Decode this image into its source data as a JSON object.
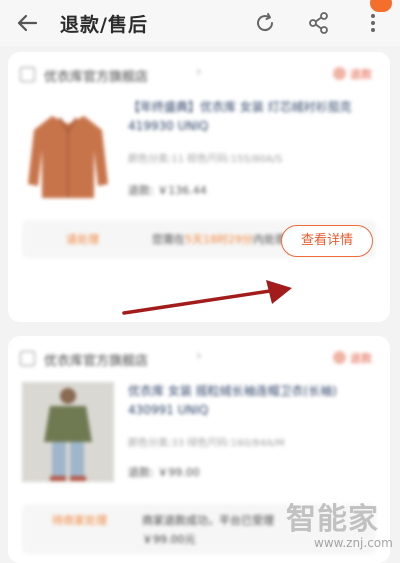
{
  "header": {
    "title": "退款/售后",
    "back_icon": "arrow-left-icon",
    "refresh_icon": "refresh-icon",
    "share_icon": "share-icon",
    "more_icon": "more-vertical-icon"
  },
  "orders": [
    {
      "store_name": "优衣库官方旗舰店",
      "status": "退款",
      "product_title": "【年终盛典】优衣库 女装 灯芯绒衬衫茄克 419930 UNIQ",
      "product_spec": "颜色分类:11 棕色尺码:155/80A/S",
      "refund_amount": "退款: ￥136.44",
      "notice_label": "请处理",
      "notice_text_pre": "您需在",
      "notice_text_highlight": "5天18时29分",
      "notice_text_post": "内处理",
      "action_label": "查看详情"
    },
    {
      "store_name": "优衣库官方旗舰店",
      "status": "退款",
      "product_title": "优衣库 女装 摇粒绒长袖连帽卫衣(长袖) 430991 UNIQ",
      "product_spec": "颜色分类:33 绿色尺码:160/84A/M",
      "refund_amount": "退款: ￥99.00",
      "notice_label": "待商家处理",
      "notice_text_line1": "商家退款成功，平台已受理",
      "notice_text_line2": "￥99.00元"
    }
  ],
  "watermark": {
    "logo_text": "智能家",
    "url": "www.znj.com"
  },
  "colors": {
    "accent": "#f06a3a",
    "highlight": "#f0863c",
    "arrow": "#a31c1c",
    "background": "#f3f3f3"
  }
}
